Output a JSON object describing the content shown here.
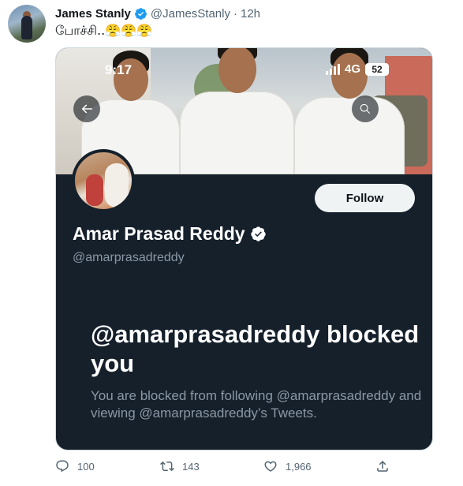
{
  "tweet": {
    "author_name": "James Stanly",
    "author_handle": "@JamesStanly",
    "separator": "·",
    "time": "12h",
    "text": "போச்சி..😤😤😤"
  },
  "embedded_screenshot": {
    "status_bar": {
      "time": "9:17",
      "network": "4G",
      "battery": "52"
    },
    "profile": {
      "name": "Amar Prasad Reddy",
      "handle": "@amarprasadreddy",
      "follow_label": "Follow"
    },
    "blocked": {
      "title": "@amarprasadreddy blocked you",
      "description": "You are blocked from following @amarprasadreddy and viewing @amarprasadreddy’s Tweets."
    },
    "colors": {
      "background": "#15202b",
      "secondary_text": "#8b98a5",
      "follow_button": "#eff3f4"
    }
  },
  "actions": {
    "replies": "100",
    "retweets": "143",
    "likes": "1,966"
  },
  "colors": {
    "verified_badge": "#1d9bf0",
    "muted_text": "#536471"
  },
  "icons": [
    "verified-badge-icon",
    "back-arrow-icon",
    "search-icon",
    "reply-icon",
    "retweet-icon",
    "like-icon",
    "share-icon"
  ]
}
